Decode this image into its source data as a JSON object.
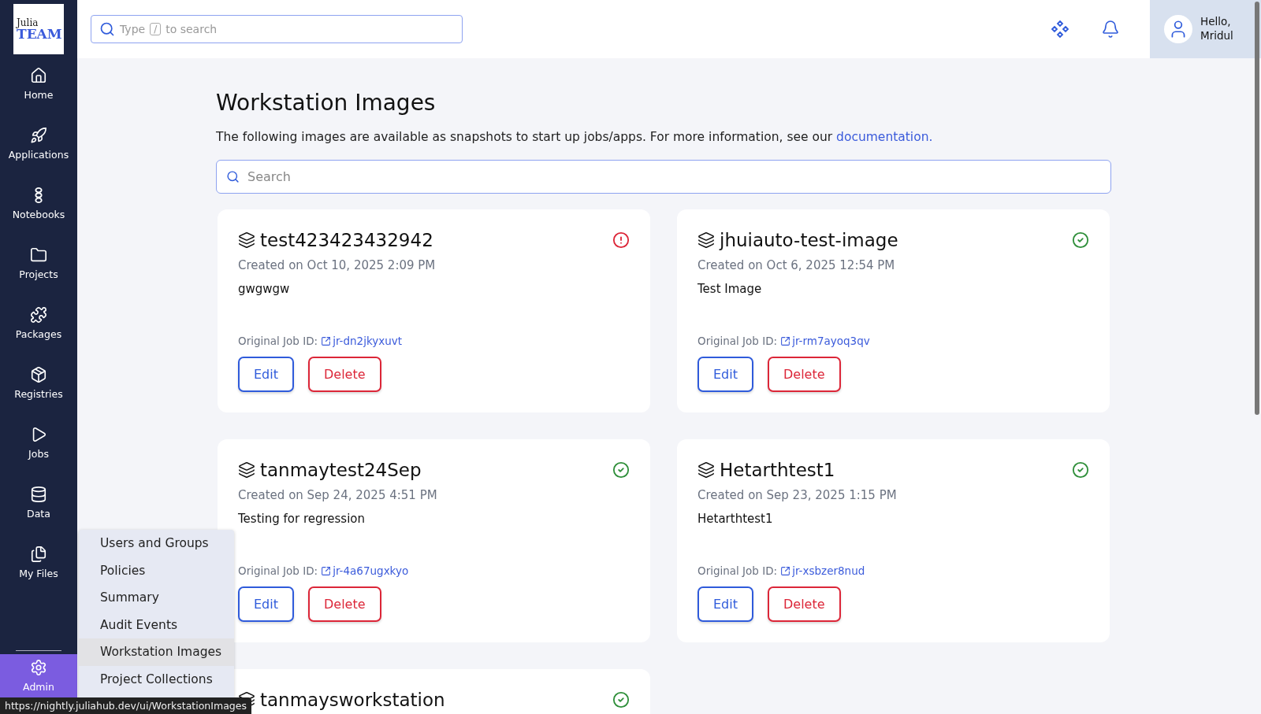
{
  "logo": {
    "line1": "Julia",
    "line2": "TEAM"
  },
  "sidebar": {
    "items": [
      {
        "label": "Home",
        "selected": false
      },
      {
        "label": "Applications",
        "selected": false
      },
      {
        "label": "Notebooks",
        "selected": false
      },
      {
        "label": "Projects",
        "selected": false
      },
      {
        "label": "Packages",
        "selected": false
      },
      {
        "label": "Registries",
        "selected": false
      },
      {
        "label": "Jobs",
        "selected": false
      },
      {
        "label": "Data",
        "selected": false
      },
      {
        "label": "My Files",
        "selected": false
      }
    ],
    "admin": {
      "label": "Admin",
      "selected": true
    }
  },
  "header": {
    "search": {
      "placeholder_before": "Type",
      "key": "/",
      "placeholder_after": "to search"
    },
    "user": {
      "greeting": "Hello,",
      "name": "Mridul"
    }
  },
  "page": {
    "title": "Workstation Images",
    "description": "The following images are available as snapshots to start up jobs/apps. For more information, see our ",
    "link": "documentation.",
    "search": {
      "placeholder": "Search"
    }
  },
  "images": [
    {
      "name": "test423423432942",
      "failed": true,
      "created": "Created on Oct 10, 2025 2:09 PM",
      "description": "gwgwgw",
      "job_label": "Original Job ID:",
      "job_id": "jr-dn2jkyxuvt",
      "edit": "Edit",
      "delete": "Delete"
    },
    {
      "name": "jhuiauto-test-image",
      "failed": false,
      "created": "Created on Oct 6, 2025 12:54 PM",
      "description": "Test Image",
      "job_label": "Original Job ID:",
      "job_id": "jr-rm7ayoq3qv",
      "edit": "Edit",
      "delete": "Delete"
    },
    {
      "name": "tanmaytest24Sep",
      "failed": false,
      "created": "Created on Sep 24, 2025 4:51 PM",
      "description": "Testing for regression",
      "job_label": "Original Job ID:",
      "job_id": "jr-4a67ugxkyo",
      "edit": "Edit",
      "delete": "Delete"
    },
    {
      "name": "Hetarthtest1",
      "failed": false,
      "created": "Created on Sep 23, 2025 1:15 PM",
      "description": "Hetarthtest1",
      "job_label": "Original Job ID:",
      "job_id": "jr-xsbzer8nud",
      "edit": "Edit",
      "delete": "Delete"
    },
    {
      "name": "tanmaysworkstation",
      "failed": false
    }
  ],
  "admin_menu": {
    "items": [
      {
        "label": "Users and Groups",
        "selected": false
      },
      {
        "label": "Policies",
        "selected": false
      },
      {
        "label": "Summary",
        "selected": false
      },
      {
        "label": "Audit Events",
        "selected": false
      },
      {
        "label": "Workstation Images",
        "selected": true
      },
      {
        "label": "Project Collections",
        "selected": false
      }
    ]
  },
  "status_url": "https://nightly.juliahub.dev/ui/WorkstationImages"
}
